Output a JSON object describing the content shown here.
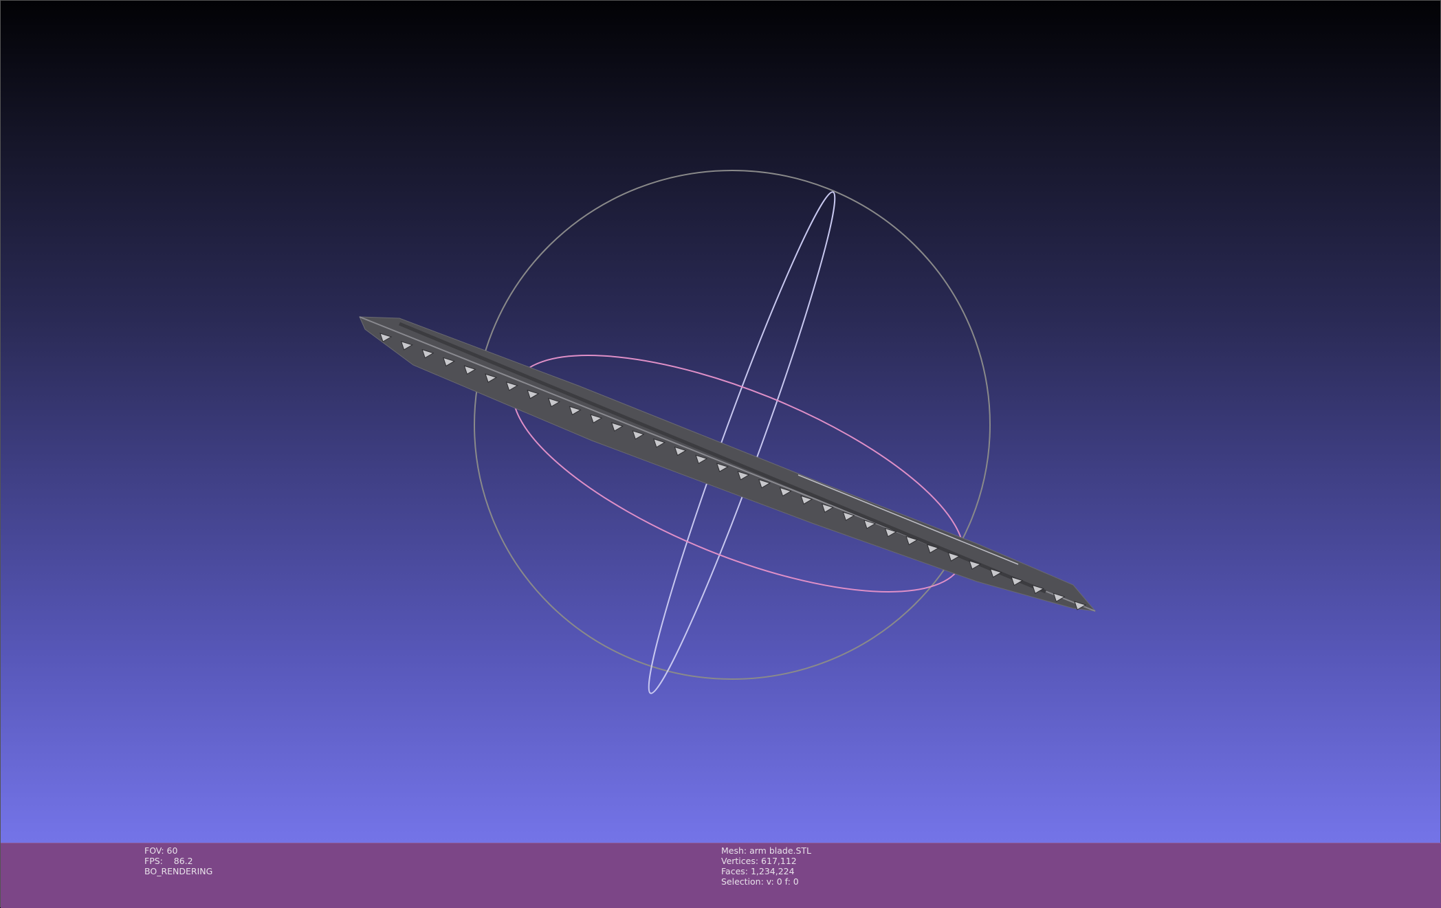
{
  "viewer": {
    "background_top": "#020205",
    "background_bottom": "#7878ee",
    "info_bar_color": "#7c4687",
    "trackball_colors": {
      "horizontal_ring": "#e090c8",
      "vertical_ring": "#c8c8f0",
      "outer_ring": "#8a8a8a"
    },
    "mesh_color": "#5a5a5e"
  },
  "info_left": {
    "fov": "FOV: 60",
    "fps": "FPS:    86.2",
    "render_mode": "BO_RENDERING"
  },
  "info_right": {
    "mesh": "Mesh: arm blade.STL",
    "vertices": "Vertices: 617,112",
    "faces": "Faces: 1,234,224",
    "selection": "Selection: v: 0 f: 0"
  }
}
